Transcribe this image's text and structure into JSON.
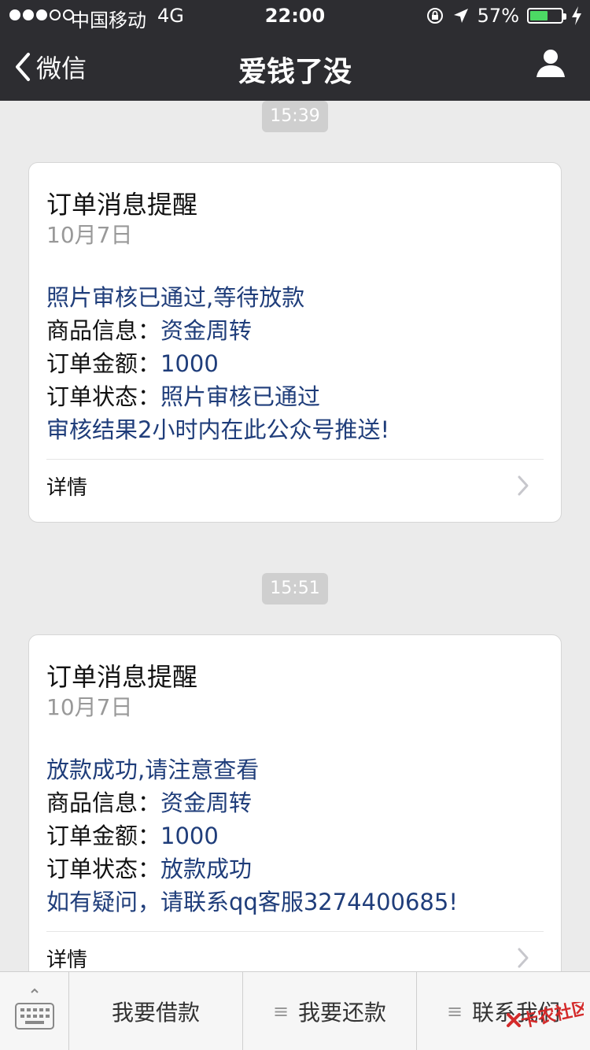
{
  "status_bar": {
    "carrier": "中国移动",
    "network": "4G",
    "time": "22:00",
    "battery_percent": "57%",
    "battery_level": 0.57,
    "battery_color": "#4cd964"
  },
  "nav": {
    "back_label": "微信",
    "title": "爱钱了没",
    "profile_icon": "person-icon"
  },
  "messages": [
    {
      "time": "15:39",
      "title": "订单消息提醒",
      "date": "10月7日",
      "headline": "照片审核已通过,等待放款",
      "product_label": "商品信息：",
      "product_value": "资金周转",
      "amount_label": "订单金额：",
      "amount_value": "1000",
      "status_label": "订单状态：",
      "status_value": "照片审核已通过",
      "footer_note": "审核结果2小时内在此公众号推送!",
      "details_label": "详情"
    },
    {
      "time": "15:51",
      "title": "订单消息提醒",
      "date": "10月7日",
      "headline": "放款成功,请注意查看",
      "product_label": "商品信息：",
      "product_value": "资金周转",
      "amount_label": "订单金额：",
      "amount_value": "1000",
      "status_label": "订单状态：",
      "status_value": "放款成功",
      "footer_note": "如有疑问，请联系qq客服3274400685!",
      "details_label": "详情"
    }
  ],
  "bottom_menu": {
    "items": [
      {
        "label": "我要借款"
      },
      {
        "label": "我要还款"
      },
      {
        "label": "联系我们"
      }
    ],
    "watermark": "卡农社区",
    "colors": {
      "text_blue": "#1f3d7a",
      "watermark_red": "#d42a2a"
    }
  }
}
